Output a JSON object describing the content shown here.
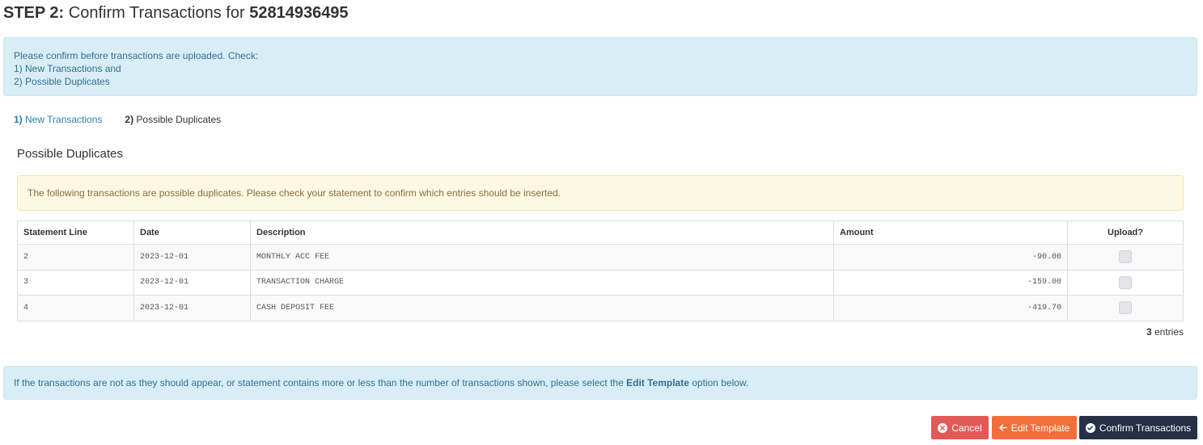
{
  "header": {
    "step_label": "STEP 2:",
    "title_text": "Confirm Transactions for",
    "account_number": "52814936495"
  },
  "info_alert": {
    "line1": "Please confirm before transactions are uploaded. Check:",
    "line2": "1) New Transactions and",
    "line3": "2) Possible Duplicates"
  },
  "steps": [
    {
      "number": "1)",
      "label": "New Transactions"
    },
    {
      "number": "2)",
      "label": "Possible Duplicates"
    }
  ],
  "section": {
    "title": "Possible Duplicates",
    "warning": "The following transactions are possible duplicates. Please check your statement to confirm which entries should be inserted."
  },
  "table": {
    "columns": [
      "Statement Line",
      "Date",
      "Description",
      "Amount",
      "Upload?"
    ],
    "rows": [
      {
        "line": "2",
        "date": "2023-12-01",
        "description": "MONTHLY ACC FEE",
        "amount": "-90.00",
        "upload": false
      },
      {
        "line": "3",
        "date": "2023-12-01",
        "description": "TRANSACTION CHARGE",
        "amount": "-159.00",
        "upload": false
      },
      {
        "line": "4",
        "date": "2023-12-01",
        "description": "CASH DEPOSIT FEE",
        "amount": "-419.70",
        "upload": false
      }
    ]
  },
  "footer_count": {
    "count": "3",
    "label": "entries"
  },
  "bottom_alert": {
    "text_before": "If the transactions are not as they should appear, or statement contains more or less than the number of transactions shown, please select the",
    "bold": "Edit Template",
    "text_after": "option below."
  },
  "buttons": {
    "cancel": "Cancel",
    "edit": "Edit Template",
    "confirm": "Confirm Transactions"
  },
  "colors": {
    "info_bg": "#d9edf7",
    "warning_bg": "#fcf8e3",
    "cancel": "#e25a57",
    "edit": "#f26f3b",
    "confirm": "#253047"
  }
}
